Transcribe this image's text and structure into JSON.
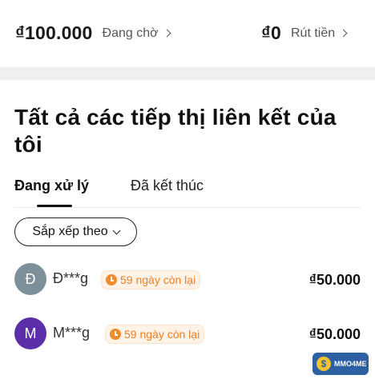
{
  "balances": {
    "pending_amount": "₫100.000",
    "pending_label": "Đang chờ",
    "withdraw_amount": "₫0",
    "withdraw_label": "Rút tiền"
  },
  "page": {
    "title": "Tất cả các tiếp thị liên kết của tôi"
  },
  "tabs": [
    {
      "label": "Đang xử lý",
      "active": true
    },
    {
      "label": "Đã kết thúc",
      "active": false
    }
  ],
  "sort": {
    "label": "Sắp xếp theo"
  },
  "affiliates": [
    {
      "initial": "Đ",
      "name": "Đ***g",
      "badge": "59 ngày còn lại",
      "amount": "₫50.000",
      "avatar_color": "#7d8f99"
    },
    {
      "initial": "M",
      "name": "M***g",
      "badge": "59 ngày còn lại",
      "amount": "₫50.000",
      "avatar_color": "#5b2fa8"
    }
  ],
  "watermark": {
    "text": "MMO4ME",
    "coin_symbol": "$"
  },
  "colors": {
    "badge_text": "#ef7d22",
    "badge_bg": "#fff3e8",
    "divider": "#efefef"
  }
}
